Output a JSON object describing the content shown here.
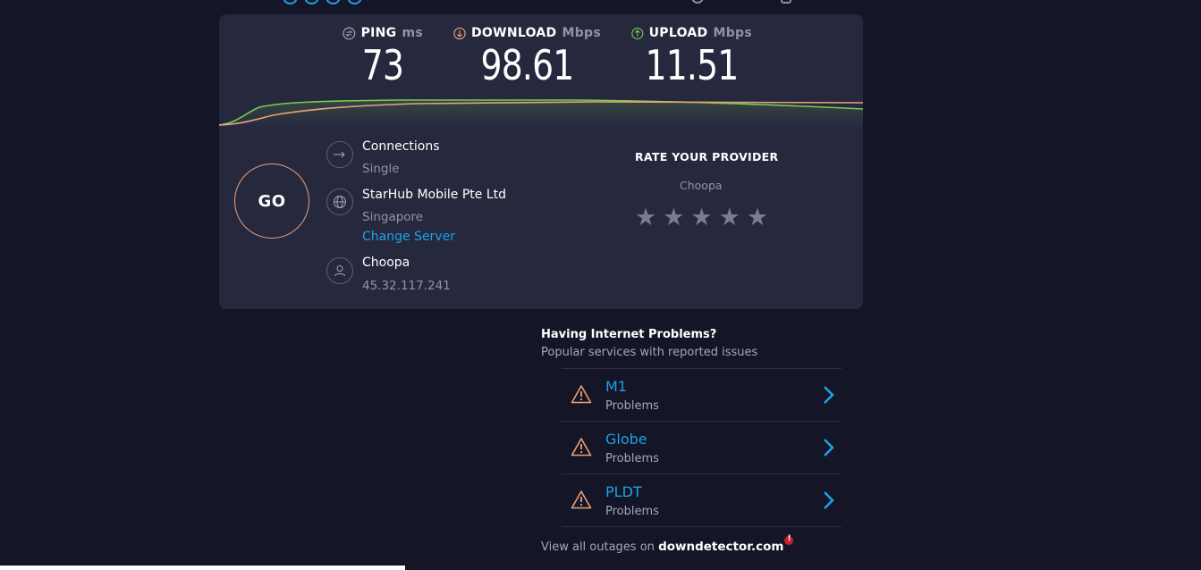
{
  "metrics": {
    "ping": {
      "label": "PING",
      "unit": "ms",
      "value": "73",
      "color": "#a5a7bc"
    },
    "download": {
      "label": "DOWNLOAD",
      "unit": "Mbps",
      "value": "98.61",
      "color": "#e8a27a"
    },
    "upload": {
      "label": "UPLOAD",
      "unit": "Mbps",
      "value": "11.51",
      "color": "#7acb4f"
    }
  },
  "go_button": {
    "label": "GO"
  },
  "connections": {
    "title": "Connections",
    "value": "Single"
  },
  "isp": {
    "name": "StarHub Mobile Pte Ltd",
    "location": "Singapore",
    "change_link": "Change Server"
  },
  "host": {
    "name": "Choopa",
    "ip": "45.32.117.241"
  },
  "rating": {
    "title": "RATE YOUR PROVIDER",
    "provider": "Choopa",
    "stars": 5,
    "star_glyph": "★"
  },
  "problems": {
    "title": "Having Internet Problems?",
    "subtitle": "Popular services with reported issues",
    "items": [
      {
        "name": "M1",
        "status": "Problems"
      },
      {
        "name": "Globe",
        "status": "Problems"
      },
      {
        "name": "PLDT",
        "status": "Problems"
      }
    ]
  },
  "outages": {
    "text": "View all outages on",
    "brand": "downdetector.com"
  },
  "colors": {
    "accent": "#1ca1e8",
    "download": "#e8a27a",
    "upload": "#7acb4f",
    "panel": "#26283e",
    "background": "#141526"
  }
}
